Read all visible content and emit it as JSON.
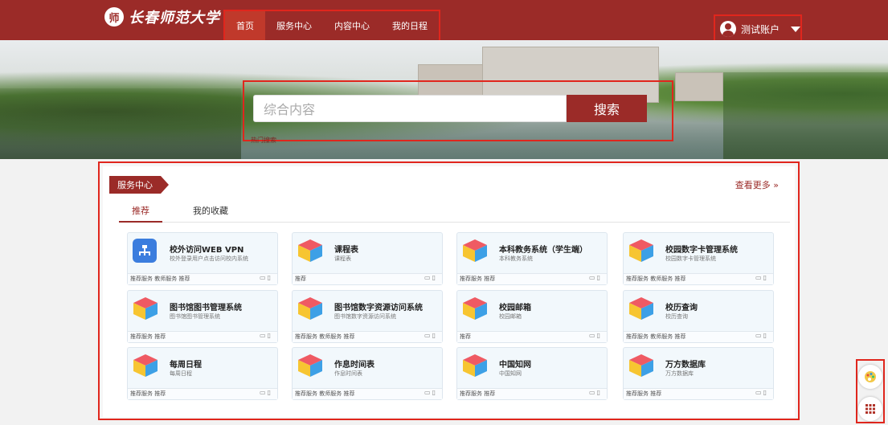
{
  "header": {
    "logo_seal": "师",
    "logo_text": "长春师范大学",
    "nav": [
      "首页",
      "服务中心",
      "内容中心",
      "我的日程"
    ],
    "account": "测试账户"
  },
  "search": {
    "placeholder": "综合内容",
    "button": "搜索",
    "hot_label": "热门搜索"
  },
  "service": {
    "title": "服务中心",
    "more": "查看更多 »",
    "tabs": [
      "推荐",
      "我的收藏"
    ],
    "cards": [
      {
        "title": "校外访问WEB VPN",
        "sub": "校外登录用户点击访问校内系统",
        "tags": "推荐服务 教师服务 推荐",
        "icon": "network-icon"
      },
      {
        "title": "课程表",
        "sub": "课程表",
        "tags": "推荐",
        "icon": "cube-icon"
      },
      {
        "title": "本科教务系统（学生端）",
        "sub": "本科教务系统",
        "tags": "推荐服务 推荐",
        "icon": "cube-icon"
      },
      {
        "title": "校园数字卡管理系统",
        "sub": "校园数字卡管理系统",
        "tags": "推荐服务 教师服务 推荐",
        "icon": "cube-icon"
      },
      {
        "title": "图书馆图书管理系统",
        "sub": "图书馆图书管理系统",
        "tags": "推荐服务 推荐",
        "icon": "cube-icon"
      },
      {
        "title": "图书馆数字资源访问系统",
        "sub": "图书馆数字资源访问系统",
        "tags": "推荐服务 教师服务 推荐",
        "icon": "cube-icon"
      },
      {
        "title": "校园邮箱",
        "sub": "校园邮箱",
        "tags": "推荐",
        "icon": "cube-icon"
      },
      {
        "title": "校历查询",
        "sub": "校历查询",
        "tags": "推荐服务 教师服务 推荐",
        "icon": "cube-icon"
      },
      {
        "title": "每周日程",
        "sub": "每周日程",
        "tags": "推荐服务 推荐",
        "icon": "cube-icon"
      },
      {
        "title": "作息时间表",
        "sub": "作息时间表",
        "tags": "推荐服务 教师服务 推荐",
        "icon": "cube-icon"
      },
      {
        "title": "中国知网",
        "sub": "中国知网",
        "tags": "推荐服务 推荐",
        "icon": "cube-icon"
      },
      {
        "title": "万方数据库",
        "sub": "万方数据库",
        "tags": "推荐服务 推荐",
        "icon": "cube-icon"
      }
    ]
  },
  "side_tools": [
    "palette-icon",
    "apps-grid-icon"
  ]
}
